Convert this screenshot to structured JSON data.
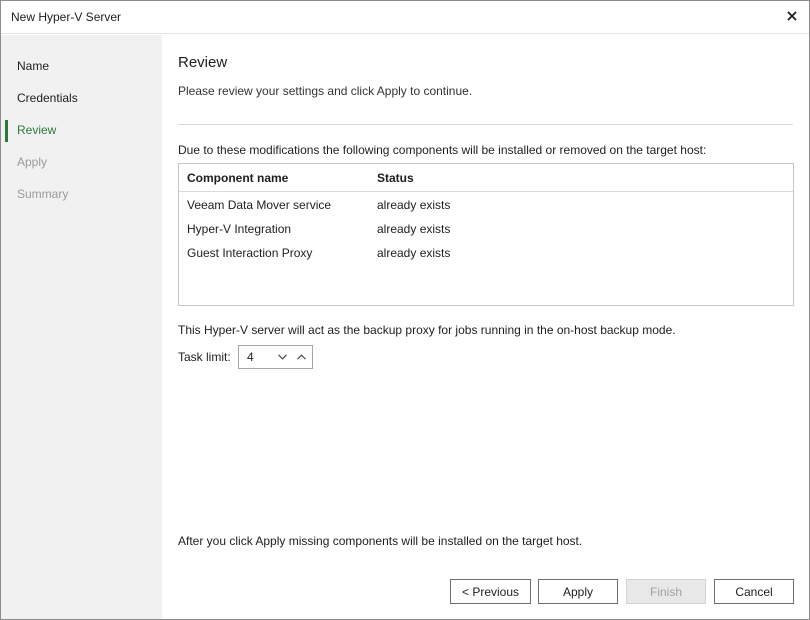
{
  "window": {
    "title": "New Hyper-V Server"
  },
  "sidebar": {
    "steps": [
      {
        "label": "Name",
        "state": "enabled"
      },
      {
        "label": "Credentials",
        "state": "enabled"
      },
      {
        "label": "Review",
        "state": "active"
      },
      {
        "label": "Apply",
        "state": "disabled"
      },
      {
        "label": "Summary",
        "state": "disabled"
      }
    ]
  },
  "main": {
    "title": "Review",
    "subtitle": "Please review your settings and click Apply to continue.",
    "intro": "Due to these modifications the following components will be installed or removed on the target host:",
    "table": {
      "columns": [
        "Component name",
        "Status"
      ],
      "rows": [
        [
          "Veeam Data Mover service",
          "already exists"
        ],
        [
          "Hyper-V Integration",
          "already exists"
        ],
        [
          "Guest Interaction Proxy",
          "already exists"
        ]
      ]
    },
    "proxy_note": "This Hyper-V server will act as the backup proxy for jobs running in the on-host backup mode.",
    "task_limit": {
      "label": "Task limit:",
      "value": "4"
    },
    "apply_note": "After you click Apply missing components will be installed on the target host."
  },
  "buttons": {
    "previous": "< Previous",
    "apply": "Apply",
    "finish": "Finish",
    "cancel": "Cancel"
  },
  "colors": {
    "accent": "#2b7a3c",
    "sidebar_bg": "#f1f1f1",
    "disabled_text": "#9a9a9a"
  }
}
